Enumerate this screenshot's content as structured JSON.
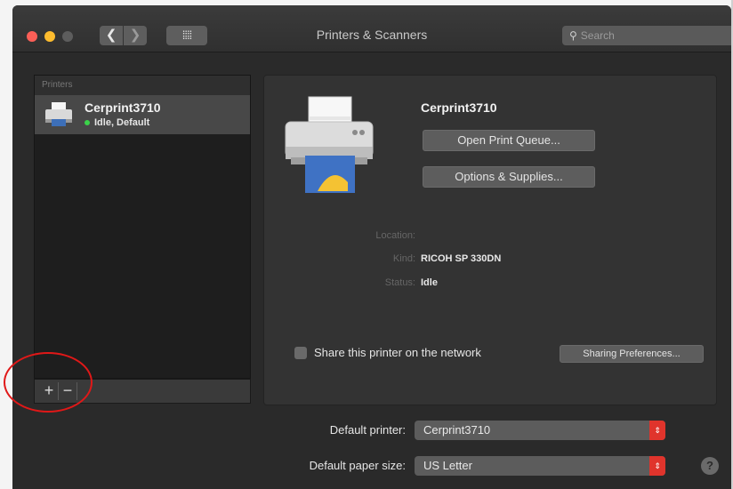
{
  "window": {
    "title": "Printers & Scanners"
  },
  "search": {
    "placeholder": "Search",
    "icon": "magnifier-icon"
  },
  "nav": {
    "back_glyph": "❮",
    "forward_glyph": "❯",
    "grid_glyph": "⁞⁞⁞⁞"
  },
  "sidebar": {
    "header": "Printers",
    "items": [
      {
        "name": "Cerprint3710",
        "status": "Idle, Default",
        "status_color": "#3bd34a"
      }
    ],
    "add_label": "+",
    "remove_label": "−"
  },
  "detail": {
    "name": "Cerprint3710",
    "open_queue_label": "Open Print Queue...",
    "options_label": "Options & Supplies...",
    "location": {
      "label": "Location:",
      "value": ""
    },
    "kind": {
      "label": "Kind:",
      "value": "RICOH SP 330DN"
    },
    "status": {
      "label": "Status:",
      "value": "Idle"
    },
    "share_label": "Share this printer on the network",
    "share_checked": false,
    "sharing_prefs_label": "Sharing Preferences..."
  },
  "defaults": {
    "printer_label": "Default printer:",
    "printer_value": "Cerprint3710",
    "paper_label": "Default paper size:",
    "paper_value": "US Letter"
  },
  "help": {
    "glyph": "?"
  },
  "colors": {
    "accent_popup": "#e0342c",
    "annotation_ring": "#e01818"
  }
}
